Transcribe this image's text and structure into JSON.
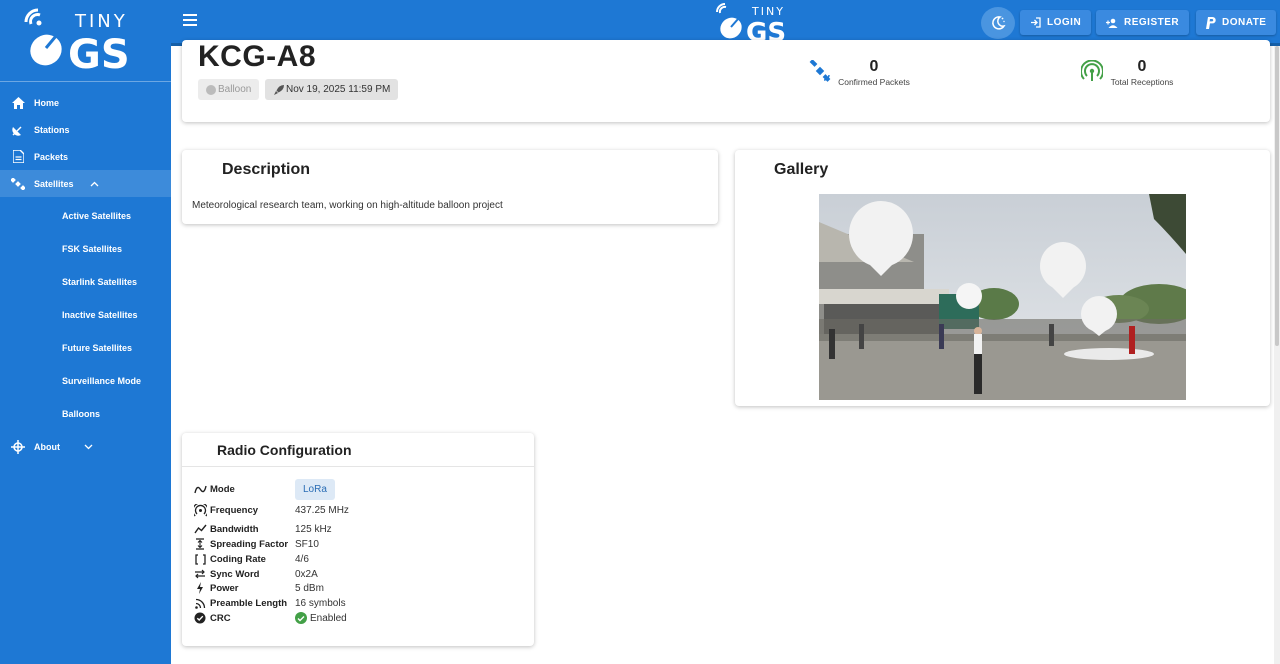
{
  "brand": {
    "tiny": "TINY",
    "gs": "GS"
  },
  "sidebar": {
    "items": [
      {
        "label": "Home",
        "icon": "home-icon"
      },
      {
        "label": "Stations",
        "icon": "satellite-dish-icon"
      },
      {
        "label": "Packets",
        "icon": "document-icon"
      },
      {
        "label": "Satellites",
        "icon": "satellite-icon"
      }
    ],
    "sub_items": [
      "Active Satellites",
      "FSK Satellites",
      "Starlink Satellites",
      "Inactive Satellites",
      "Future Satellites",
      "Surveillance Mode",
      "Balloons"
    ],
    "about": "About"
  },
  "topbar": {
    "login": "LOGIN",
    "register": "REGISTER",
    "donate": "DONATE"
  },
  "satellite": {
    "name": "KCG-A8",
    "type": "Balloon",
    "launch_date": "Nov 19, 2025 11:59 PM",
    "confirmed_packets": "0",
    "confirmed_packets_label": "Confirmed Packets",
    "total_receptions": "0",
    "total_receptions_label": "Total Receptions"
  },
  "description": {
    "title": "Description",
    "text": "Meteorological research team, working on high-altitude balloon project"
  },
  "gallery": {
    "title": "Gallery"
  },
  "radio": {
    "title": "Radio Configuration",
    "rows": [
      {
        "label": "Mode",
        "value": "LoRa",
        "icon": "wave-icon"
      },
      {
        "label": "Frequency",
        "value": "437.25 MHz",
        "icon": "antenna-icon"
      },
      {
        "label": "Bandwidth",
        "value": "125 kHz",
        "icon": "line-chart-icon"
      },
      {
        "label": "Spreading Factor",
        "value": "SF10",
        "icon": "vertical-expand-icon"
      },
      {
        "label": "Coding Rate",
        "value": "4/6",
        "icon": "brackets-icon"
      },
      {
        "label": "Sync Word",
        "value": "0x2A",
        "icon": "swap-icon"
      },
      {
        "label": "Power",
        "value": "5 dBm",
        "icon": "bolt-icon"
      },
      {
        "label": "Preamble Length",
        "value": "16 symbols",
        "icon": "signal-icon"
      },
      {
        "label": "CRC",
        "value": "Enabled",
        "icon": "verified-icon"
      }
    ]
  },
  "colors": {
    "primary": "#1e78d4",
    "success": "#43a047",
    "chip_blue": "#dde9f6"
  }
}
